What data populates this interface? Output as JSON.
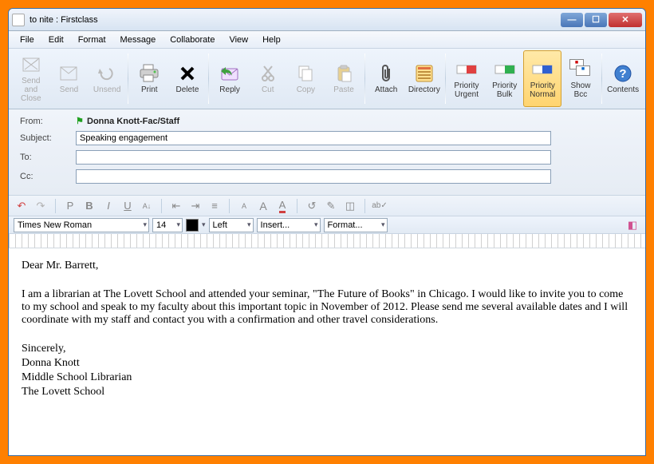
{
  "window": {
    "title": "to nite : Firstclass"
  },
  "menu": {
    "file": "File",
    "edit": "Edit",
    "format": "Format",
    "message": "Message",
    "collaborate": "Collaborate",
    "view": "View",
    "help": "Help"
  },
  "toolbar": {
    "send_close": "Send and Close",
    "send": "Send",
    "unsend": "Unsend",
    "print": "Print",
    "delete": "Delete",
    "reply": "Reply",
    "cut": "Cut",
    "copy": "Copy",
    "paste": "Paste",
    "attach": "Attach",
    "directory": "Directory",
    "priority_urgent": "Priority Urgent",
    "priority_bulk": "Priority Bulk",
    "priority_normal": "Priority Normal",
    "show_bcc": "Show Bcc",
    "contents": "Contents"
  },
  "headers": {
    "from_label": "From:",
    "from_value": "Donna Knott-Fac/Staff",
    "subject_label": "Subject:",
    "subject_value": "Speaking engagement",
    "to_label": "To:",
    "to_value": "",
    "cc_label": "Cc:",
    "cc_value": ""
  },
  "format_row": {
    "font": "Times New Roman",
    "size": "14",
    "align": "Left",
    "insert": "Insert...",
    "format": "Format..."
  },
  "body": {
    "greeting": "Dear Mr. Barrett,",
    "p1": "I am a librarian at The Lovett School and attended your seminar, \"The Future of Books\" in Chicago.  I would like to invite you to come to my school and speak to my faculty about this important topic in November of 2012.  Please send me several available dates and I will coordinate with my staff and contact you with a confirmation and other travel considerations.",
    "closing": "Sincerely,",
    "sig1": "Donna Knott",
    "sig2": "Middle School Librarian",
    "sig3": "The Lovett School"
  }
}
